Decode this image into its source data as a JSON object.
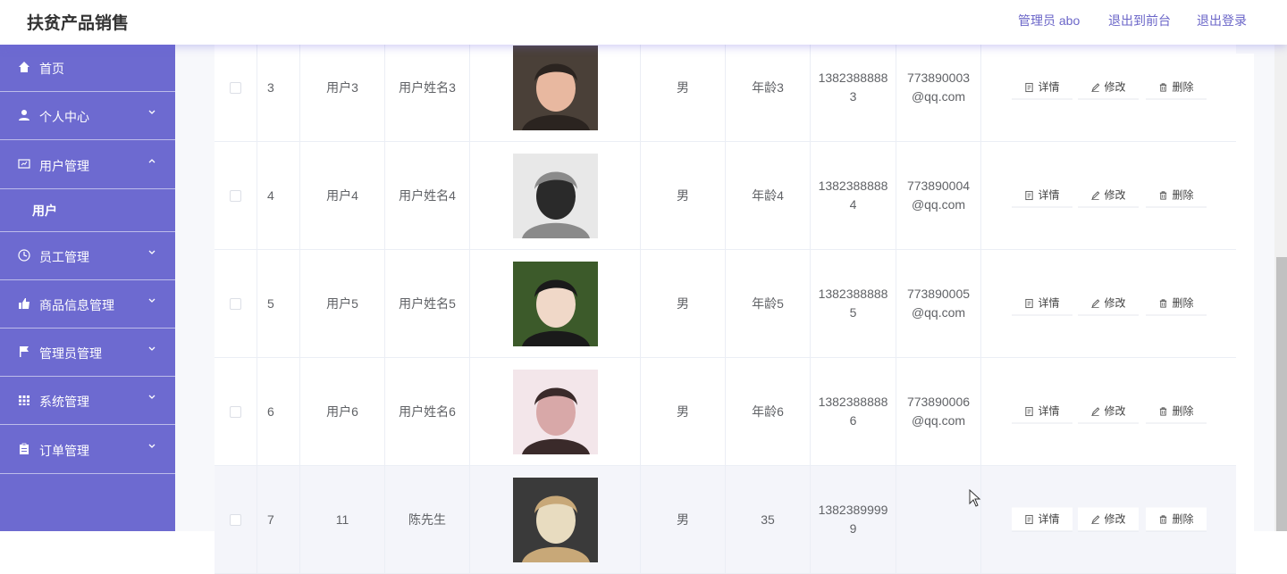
{
  "header": {
    "brand": "扶贫产品销售",
    "admin_label": "管理员 abo",
    "back_front": "退出到前台",
    "logout": "退出登录"
  },
  "sidebar": {
    "items": [
      {
        "label": "首页",
        "icon": "home-icon"
      },
      {
        "label": "个人中心",
        "icon": "user-icon"
      },
      {
        "label": "用户管理",
        "icon": "monitor-icon",
        "expanded": true
      },
      {
        "label": "员工管理",
        "icon": "clock-icon"
      },
      {
        "label": "商品信息管理",
        "icon": "thumb-icon"
      },
      {
        "label": "管理员管理",
        "icon": "flag-icon"
      },
      {
        "label": "系统管理",
        "icon": "grid-icon"
      },
      {
        "label": "订单管理",
        "icon": "clipboard-icon"
      }
    ],
    "sub_items": [
      {
        "label": "用户"
      }
    ]
  },
  "table": {
    "actions": {
      "detail": "详情",
      "edit": "修改",
      "delete": "删除"
    },
    "rows": [
      {
        "index": "3",
        "account": "用户3",
        "name": "用户姓名3",
        "gender": "男",
        "age": "年龄3",
        "phone": "13823888883",
        "email": "773890003@qq.com",
        "avatar_colors": [
          "#4a4038",
          "#e8b8a0",
          "#2b2420"
        ]
      },
      {
        "index": "4",
        "account": "用户4",
        "name": "用户姓名4",
        "gender": "男",
        "age": "年龄4",
        "phone": "13823888884",
        "email": "773890004@qq.com",
        "avatar_colors": [
          "#e8e8e8",
          "#2a2a2a",
          "#8a8a8a"
        ]
      },
      {
        "index": "5",
        "account": "用户5",
        "name": "用户姓名5",
        "gender": "男",
        "age": "年龄5",
        "phone": "13823888885",
        "email": "773890005@qq.com",
        "avatar_colors": [
          "#3c5a2a",
          "#f0d8c8",
          "#1a1a1a"
        ]
      },
      {
        "index": "6",
        "account": "用户6",
        "name": "用户姓名6",
        "gender": "男",
        "age": "年龄6",
        "phone": "13823888886",
        "email": "773890006@qq.com",
        "avatar_colors": [
          "#f3e6ea",
          "#d8a8a8",
          "#3a2a2a"
        ]
      },
      {
        "index": "7",
        "account": "11",
        "name": "陈先生",
        "gender": "男",
        "age": "35",
        "phone": "13823899999",
        "email": "",
        "avatar_colors": [
          "#3a3a3a",
          "#e8dcc0",
          "#c8a878"
        ]
      }
    ]
  },
  "colors": {
    "sidebar": "#6d6ad0",
    "accent": "#6b66c8"
  }
}
